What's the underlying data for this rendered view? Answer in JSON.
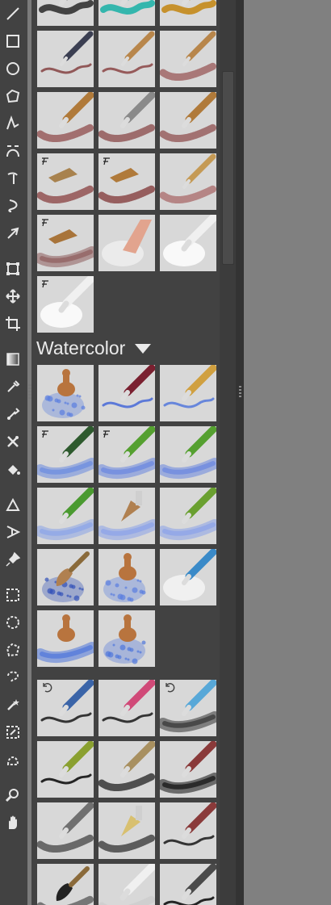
{
  "toolbar": {
    "tools": [
      {
        "icon": "line-icon",
        "group": 1
      },
      {
        "icon": "rectangle-icon",
        "group": 1
      },
      {
        "icon": "ellipse-icon",
        "group": 1
      },
      {
        "icon": "polygon-icon",
        "group": 1
      },
      {
        "icon": "polyline-icon",
        "group": 1
      },
      {
        "icon": "bezier-curve-icon",
        "group": 1
      },
      {
        "icon": "dynamic-brush-icon",
        "group": 1
      },
      {
        "icon": "freehand-path-icon",
        "group": 1
      },
      {
        "icon": "multibrush-icon",
        "group": 1
      },
      {
        "icon": "transform-icon",
        "group": 2
      },
      {
        "icon": "move-icon",
        "group": 2
      },
      {
        "icon": "crop-icon",
        "group": 2
      },
      {
        "icon": "gradient-icon",
        "group": 3
      },
      {
        "icon": "color-picker-icon",
        "group": 3
      },
      {
        "icon": "smart-patch-icon",
        "group": 3
      },
      {
        "icon": "colorize-mask-icon",
        "group": 3
      },
      {
        "icon": "fill-icon",
        "group": 3
      },
      {
        "icon": "assistant-icon",
        "group": 4
      },
      {
        "icon": "perspective-grid-icon",
        "group": 4
      },
      {
        "icon": "reference-pin-icon",
        "group": 4
      },
      {
        "icon": "rectangle-select-icon",
        "group": 5
      },
      {
        "icon": "ellipse-select-icon",
        "group": 5
      },
      {
        "icon": "polygon-select-icon",
        "group": 5
      },
      {
        "icon": "freehand-select-icon",
        "group": 5
      },
      {
        "icon": "magic-wand-select-icon",
        "group": 5
      },
      {
        "icon": "similar-color-select-icon",
        "group": 5
      },
      {
        "icon": "bezier-select-icon",
        "group": 5
      },
      {
        "icon": "zoom-icon",
        "group": 6
      },
      {
        "icon": "pan-hand-icon",
        "group": 6
      }
    ]
  },
  "brush_panel": {
    "groups": [
      {
        "label": "",
        "items": [
          {
            "tool": "marker",
            "color": "#555555",
            "stroke": "#333333",
            "texture": "smooth"
          },
          {
            "tool": "marker",
            "color": "#2aa9a0",
            "stroke": "#22b2a8",
            "texture": "smooth"
          },
          {
            "tool": "marker",
            "color": "#c9901f",
            "stroke": "#c4891a",
            "texture": "smooth"
          },
          {
            "tool": "pencil",
            "color": "#3b3f52",
            "stroke": "#8a4a4a",
            "texture": "line"
          },
          {
            "tool": "pencil",
            "color": "#b8864b",
            "stroke": "#8f4c4c",
            "texture": "line"
          },
          {
            "tool": "pencil",
            "color": "#b8864b",
            "stroke": "#9a5858",
            "texture": "grain"
          },
          {
            "tool": "crayon",
            "color": "#b07a3a",
            "stroke": "#904c4c",
            "texture": "grain"
          },
          {
            "tool": "crayon",
            "color": "#8a8a8a",
            "stroke": "#8a4848",
            "texture": "grain"
          },
          {
            "tool": "crayon",
            "color": "#b07a3a",
            "stroke": "#905050",
            "texture": "grain"
          },
          {
            "tool": "chalk",
            "color": "#a8824e",
            "stroke": "#8a4040",
            "texture": "grain",
            "tilt": true
          },
          {
            "tool": "chalk",
            "color": "#b07a3a",
            "stroke": "#803636",
            "texture": "grain",
            "tilt": true
          },
          {
            "tool": "pencil",
            "color": "#c59a55",
            "stroke": "#aa6a6a",
            "texture": "grain"
          },
          {
            "tool": "chalk",
            "color": "#a8743a",
            "stroke": "#8e5c5c",
            "texture": "soft",
            "tilt": true
          },
          {
            "tool": "finger",
            "color": "#e2a48e",
            "stroke": "#eeeeee",
            "texture": "smudge"
          },
          {
            "tool": "stick",
            "color": "#f0f0f0",
            "stroke": "#ffffff",
            "texture": "smudge"
          },
          {
            "tool": "stick",
            "color": "#f0f0f0",
            "stroke": "#ffffff",
            "texture": "smudge",
            "tilt": true
          }
        ]
      },
      {
        "label": "Watercolor",
        "items": [
          {
            "tool": "stamp",
            "color": "#b8743e",
            "stroke": "#5a7ee0",
            "texture": "speckle"
          },
          {
            "tool": "brush",
            "color": "#7a2030",
            "stroke": "#4f6fd8",
            "texture": "line"
          },
          {
            "tool": "brush",
            "color": "#d0a040",
            "stroke": "#5b7ddc",
            "texture": "line"
          },
          {
            "tool": "marker",
            "color": "#2e5a2e",
            "stroke": "#6a8ae0",
            "texture": "wash",
            "tilt": true
          },
          {
            "tool": "brush",
            "color": "#55a030",
            "stroke": "#6a86e0",
            "texture": "wash",
            "tilt": true
          },
          {
            "tool": "brush",
            "color": "#55a030",
            "stroke": "#6a86e0",
            "texture": "wash"
          },
          {
            "tool": "brush",
            "color": "#4a9a30",
            "stroke": "#8aa4e8",
            "texture": "soft"
          },
          {
            "tool": "flat",
            "color": "#b08050",
            "stroke": "#8aa2ea",
            "texture": "soft"
          },
          {
            "tool": "brush",
            "color": "#6aa030",
            "stroke": "#8aa2ea",
            "texture": "soft"
          },
          {
            "tool": "round",
            "color": "#b08050",
            "stroke": "#3050b8",
            "texture": "speckle"
          },
          {
            "tool": "stamp",
            "color": "#b8743e",
            "stroke": "#5a7ee0",
            "texture": "speckle"
          },
          {
            "tool": "brush",
            "color": "#3a8ac8",
            "stroke": "#f4f4f4",
            "texture": "smudge"
          },
          {
            "tool": "stamp",
            "color": "#b8743e",
            "stroke": "#4f76dc",
            "texture": "wash"
          },
          {
            "tool": "stamp",
            "color": "#b8743e",
            "stroke": "#4f76dc",
            "texture": "speckle"
          }
        ]
      },
      {
        "label": "",
        "items": [
          {
            "tool": "marker",
            "color": "#3a64a8",
            "stroke": "#222222",
            "texture": "line",
            "sync": true
          },
          {
            "tool": "marker",
            "color": "#d04a78",
            "stroke": "#222222",
            "texture": "line"
          },
          {
            "tool": "marker",
            "color": "#58a8d8",
            "stroke": "#333333",
            "texture": "wash",
            "sync": true
          },
          {
            "tool": "brush",
            "color": "#8aa030",
            "stroke": "#111111",
            "texture": "line"
          },
          {
            "tool": "brush",
            "color": "#a89060",
            "stroke": "#222222",
            "texture": "grain"
          },
          {
            "tool": "brush",
            "color": "#8a3a3a",
            "stroke": "#111111",
            "texture": "wash"
          },
          {
            "tool": "brush",
            "color": "#707070",
            "stroke": "#444444",
            "texture": "grain"
          },
          {
            "tool": "flat",
            "color": "#d8c070",
            "stroke": "#333333",
            "texture": "grain"
          },
          {
            "tool": "brush",
            "color": "#8a3a3a",
            "stroke": "#222222",
            "texture": "line"
          },
          {
            "tool": "round",
            "color": "#222222",
            "stroke": "#555555",
            "texture": "grain"
          },
          {
            "tool": "stick",
            "color": "#f0f0f0",
            "stroke": "#cccccc",
            "texture": "grain"
          },
          {
            "tool": "brush",
            "color": "#4a4a4a",
            "stroke": "#111111",
            "texture": "line"
          }
        ]
      }
    ]
  }
}
